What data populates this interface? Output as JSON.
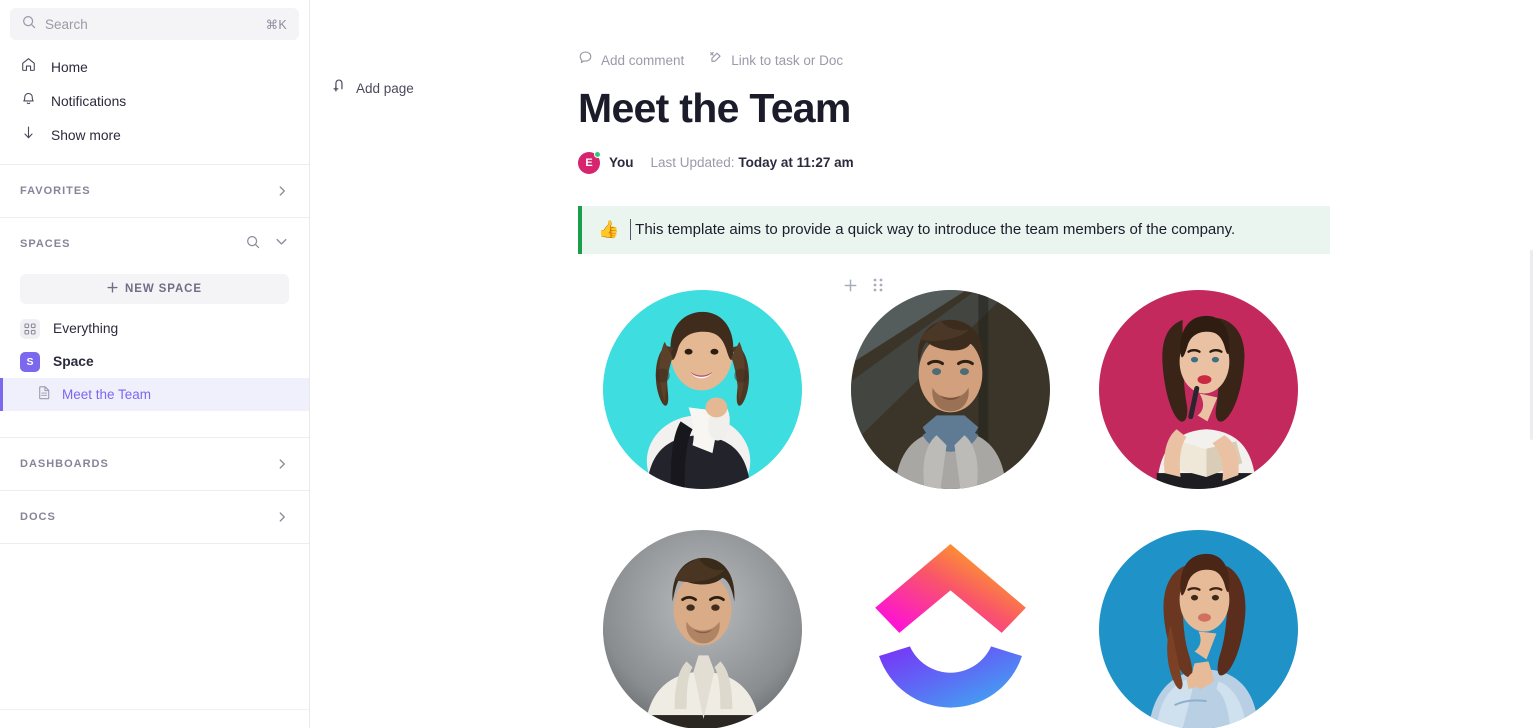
{
  "sidebar": {
    "search": {
      "placeholder": "Search",
      "shortcut": "⌘K"
    },
    "nav": [
      {
        "label": "Home",
        "icon": "home-icon"
      },
      {
        "label": "Notifications",
        "icon": "bell-icon"
      },
      {
        "label": "Show more",
        "icon": "arrow-down-icon"
      }
    ],
    "favorites": {
      "label": "FAVORITES"
    },
    "spaces": {
      "label": "SPACES",
      "new_space_label": "NEW SPACE",
      "items": [
        {
          "label": "Everything",
          "icon": "grid-icon",
          "badge": ""
        },
        {
          "label": "Space",
          "icon": "space-icon",
          "badge": "S"
        }
      ],
      "doc": {
        "label": "Meet the Team",
        "icon": "doc-icon"
      }
    },
    "dashboards": {
      "label": "DASHBOARDS"
    },
    "docs": {
      "label": "DOCS"
    }
  },
  "main": {
    "add_page_label": "Add page",
    "actions": [
      {
        "label": "Add comment",
        "icon": "comment-icon"
      },
      {
        "label": "Link to task or Doc",
        "icon": "link-icon"
      }
    ],
    "title": "Meet the Team",
    "meta": {
      "avatar_initial": "E",
      "author": "You",
      "updated_prefix": "Last Updated:",
      "updated_value": "Today at 11:27 am"
    },
    "callout": {
      "emoji": "👍",
      "text": "This template aims to provide a quick way to introduce the team members of the company."
    },
    "hover_tools": [
      {
        "icon": "plus-icon"
      },
      {
        "icon": "drag-handle-icon"
      }
    ],
    "team": [
      {
        "name": "team-photo-1",
        "type": "photo",
        "bg": "#3ddde0"
      },
      {
        "name": "team-photo-2",
        "type": "photo",
        "bg": "#3a3528"
      },
      {
        "name": "team-photo-3",
        "type": "photo",
        "bg": "#c4295e"
      },
      {
        "name": "team-photo-4",
        "type": "photo",
        "bg": "#8f9295"
      },
      {
        "name": "clickup-logo",
        "type": "logo",
        "bg": "#ffffff"
      },
      {
        "name": "team-photo-6",
        "type": "photo",
        "bg": "#1f93c8"
      }
    ]
  },
  "colors": {
    "accent": "#7b68ee",
    "callout_border": "#1a9e4b",
    "callout_bg": "#e9f5ee",
    "avatar_bg": "#d6246e",
    "online_dot": "#2ecc71"
  }
}
